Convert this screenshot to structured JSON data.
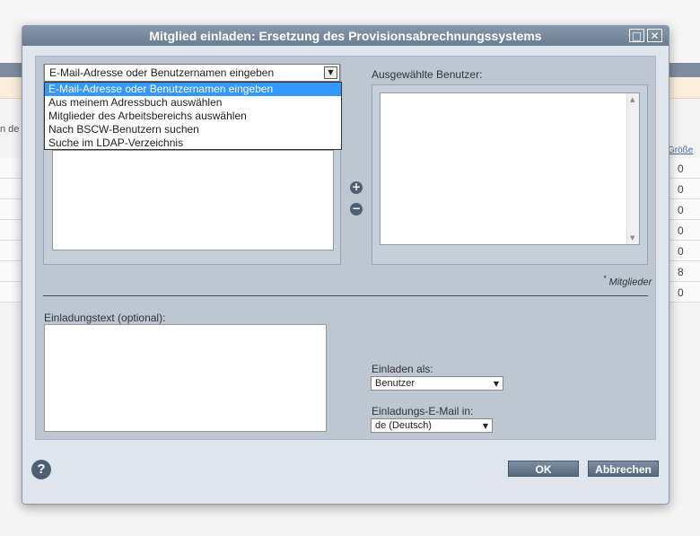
{
  "background": {
    "left_text": "n de",
    "column_header": "Größe",
    "row_values": [
      "0",
      "0",
      "0",
      "0",
      "0",
      "8",
      "0"
    ]
  },
  "dialog": {
    "title": "Mitglied einladen: Ersetzung des Provisionsabrechnungssystems",
    "maximize_symbol": "□",
    "close_symbol": "✕",
    "search_select_value": "E-Mail-Adresse oder Benutzernamen eingeben",
    "dropdown_options": [
      "E-Mail-Adresse oder Benutzernamen eingeben",
      "Aus meinem Adressbuch auswählen",
      "Mitglieder des Arbeitsbereichs auswählen",
      "Nach BSCW-Benutzern suchen",
      "Suche im LDAP-Verzeichnis"
    ],
    "selected_users_label": "Ausgewählte Benutzer:",
    "add_symbol": "+",
    "remove_symbol": "−",
    "members_note_mark": "*",
    "members_note": "Mitglieder",
    "invitation_text_label": "Einladungstext (optional):",
    "invite_as_label": "Einladen als:",
    "invite_as_value": "Benutzer",
    "email_lang_label": "Einladungs-E-Mail in:",
    "email_lang_value": "de (Deutsch)",
    "help_symbol": "?",
    "ok_label": "OK",
    "cancel_label": "Abbrechen"
  },
  "icons": {
    "dropdown_caret": "▼",
    "scroll_up": "▲",
    "scroll_down": "▼"
  }
}
